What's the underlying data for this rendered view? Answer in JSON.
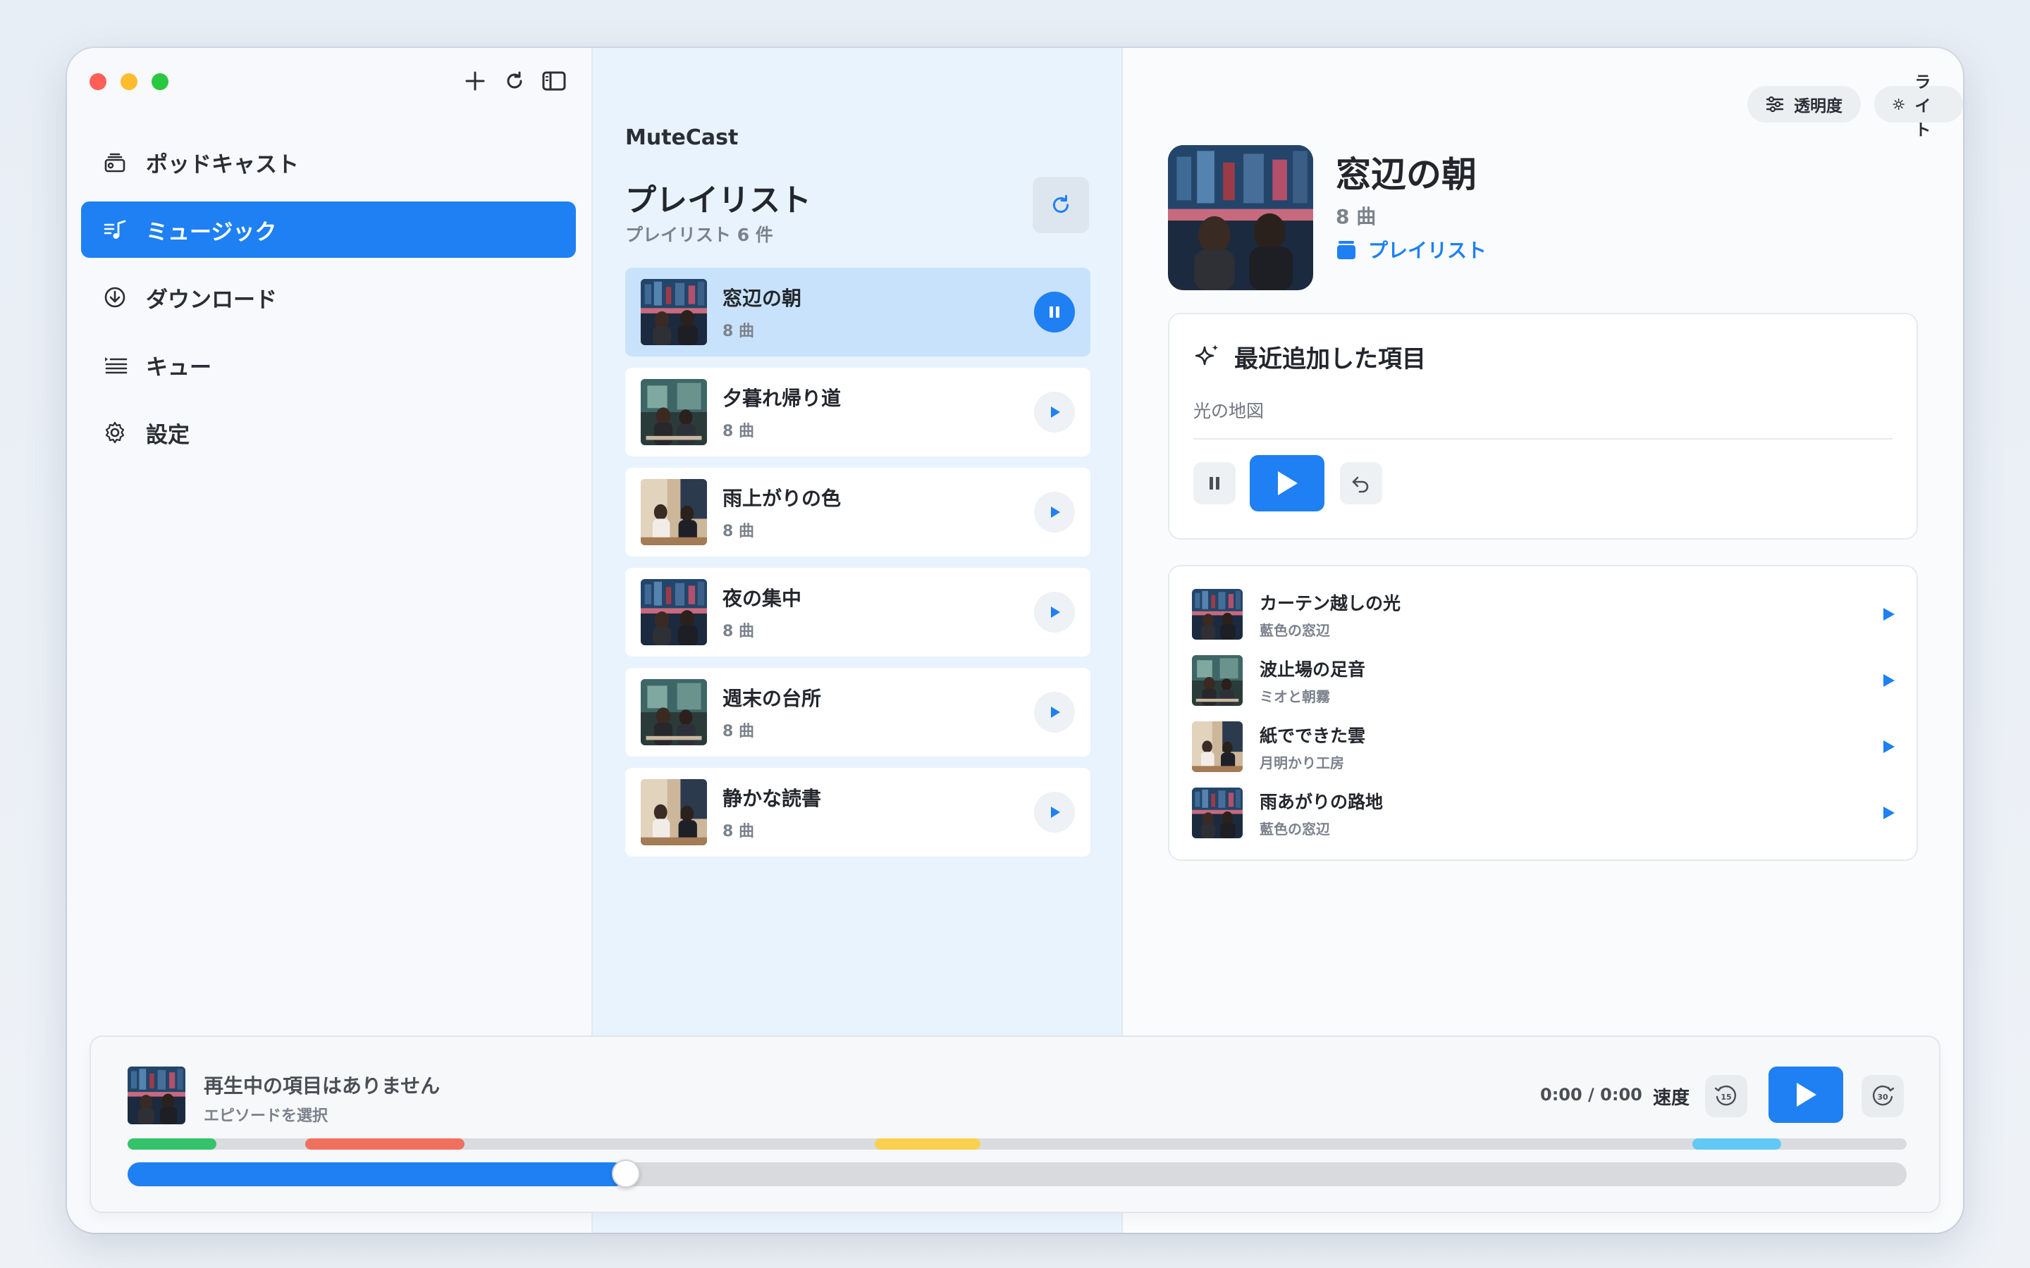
{
  "sidebar": {
    "items": [
      {
        "label": "ポッドキャスト",
        "icon": "podcast-icon"
      },
      {
        "label": "ミュージック",
        "icon": "music-icon",
        "active": true
      },
      {
        "label": "ダウンロード",
        "icon": "download-icon"
      },
      {
        "label": "キュー",
        "icon": "queue-icon"
      },
      {
        "label": "設定",
        "icon": "gear-icon"
      }
    ]
  },
  "middle": {
    "app_name": "MuteCast",
    "title": "プレイリスト",
    "count": "プレイリスト 6 件",
    "playlists": [
      {
        "name": "窓辺の朝",
        "sub": "8 曲",
        "playing": true
      },
      {
        "name": "夕暮れ帰り道",
        "sub": "8 曲"
      },
      {
        "name": "雨上がりの色",
        "sub": "8 曲"
      },
      {
        "name": "夜の集中",
        "sub": "8 曲"
      },
      {
        "name": "週末の台所",
        "sub": "8 曲"
      },
      {
        "name": "静かな読書",
        "sub": "8 曲"
      }
    ]
  },
  "detail": {
    "opacity_label": "透明度",
    "theme_label": "ライト",
    "title": "窓辺の朝",
    "count": "8 曲",
    "type_link": "プレイリスト",
    "recent_title": "最近追加した項目",
    "recent_item": "光の地図",
    "tracks": [
      {
        "name": "カーテン越しの光",
        "artist": "藍色の窓辺"
      },
      {
        "name": "波止場の足音",
        "artist": "ミオと朝霧"
      },
      {
        "name": "紙でできた雲",
        "artist": "月明かり工房"
      },
      {
        "name": "雨あがりの路地",
        "artist": "藍色の窓辺"
      }
    ]
  },
  "player": {
    "title": "再生中の項目はありません",
    "subtitle": "エピソードを選択",
    "time": "0:00 / 0:00",
    "speed_label": "速度",
    "progress": 0.28,
    "colors": {
      "accent": "#1e80f2",
      "green": "#34c26b",
      "red": "#f0705e",
      "yellow": "#fbd050",
      "cyan": "#62c8f5"
    }
  }
}
